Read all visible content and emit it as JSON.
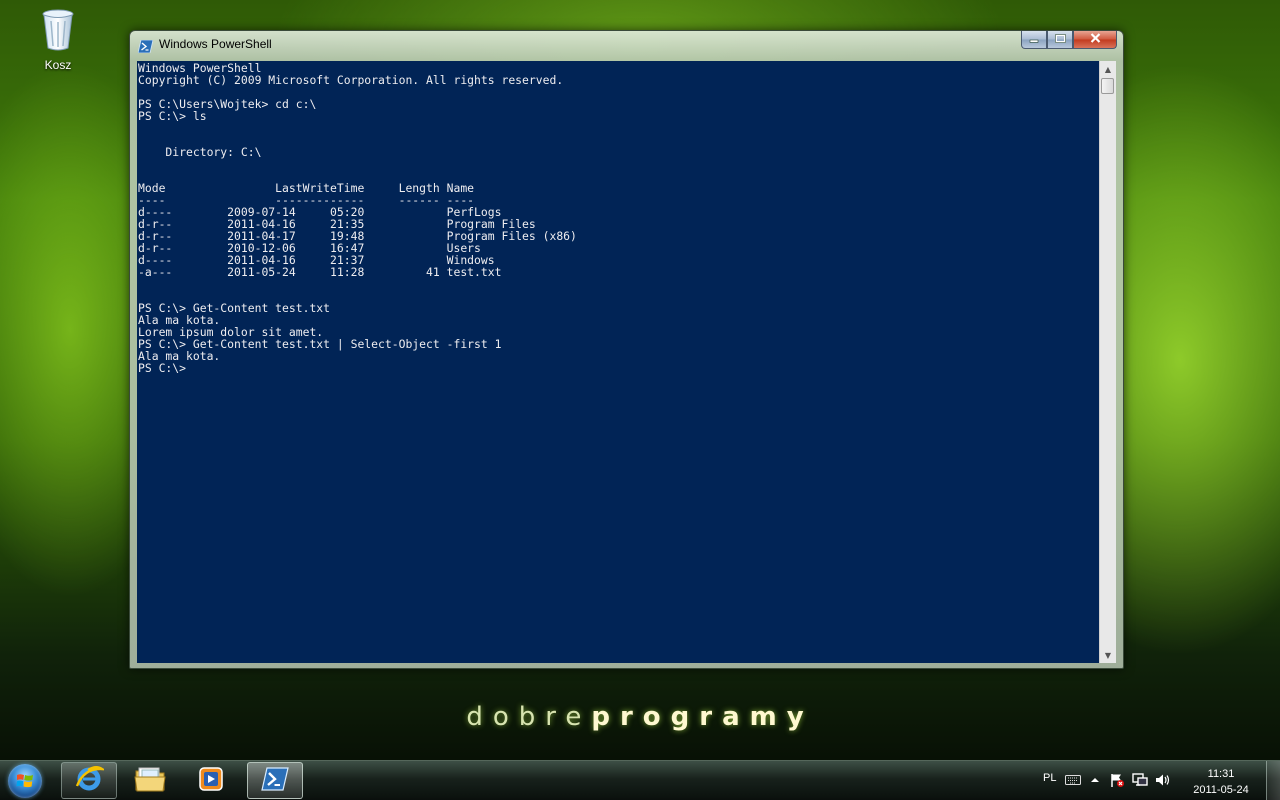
{
  "desktop": {
    "recycle_bin_label": "Kosz",
    "watermark_thin": "dobre",
    "watermark_bold": "programy"
  },
  "window": {
    "title": "Windows PowerShell",
    "icon": "powershell-icon",
    "buttons": {
      "minimize": "minimize-icon",
      "maximize": "maximize-icon",
      "close": "close-icon"
    },
    "console": {
      "background": "#012456",
      "foreground": "#eeedf0",
      "lines": [
        "Windows PowerShell",
        "Copyright (C) 2009 Microsoft Corporation. All rights reserved.",
        "",
        "PS C:\\Users\\Wojtek> cd c:\\",
        "PS C:\\> ls",
        "",
        "",
        "    Directory: C:\\",
        "",
        "",
        "Mode                LastWriteTime     Length Name",
        "----                -------------     ------ ----",
        "d----        2009-07-14     05:20            PerfLogs",
        "d-r--        2011-04-16     21:35            Program Files",
        "d-r--        2011-04-17     19:48            Program Files (x86)",
        "d-r--        2010-12-06     16:47            Users",
        "d----        2011-04-16     21:37            Windows",
        "-a---        2011-05-24     11:28         41 test.txt",
        "",
        "",
        "PS C:\\> Get-Content test.txt",
        "Ala ma kota.",
        "Lorem ipsum dolor sit amet.",
        "PS C:\\> Get-Content test.txt | Select-Object -first 1",
        "Ala ma kota.",
        "PS C:\\>"
      ]
    }
  },
  "taskbar": {
    "start_icon": "windows-start-icon",
    "pinned": [
      {
        "name": "internet-explorer",
        "icon": "internet-explorer-icon"
      },
      {
        "name": "windows-explorer",
        "icon": "folder-icon"
      },
      {
        "name": "media-player",
        "icon": "media-player-icon"
      },
      {
        "name": "powershell",
        "icon": "powershell-icon",
        "active": true
      }
    ],
    "tray": {
      "language": "PL",
      "icons": [
        "keyboard-icon",
        "show-hidden-icons-arrow",
        "action-center-flag-icon",
        "network-icon",
        "volume-icon"
      ],
      "time": "11:31",
      "date": "2011-05-24"
    }
  }
}
